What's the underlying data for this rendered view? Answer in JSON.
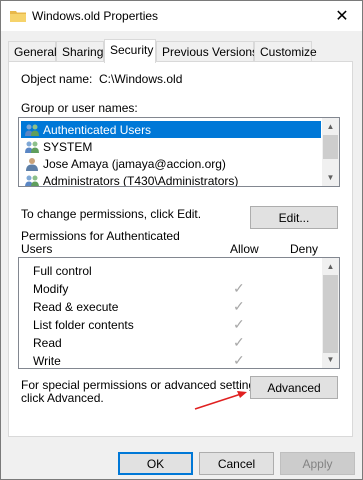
{
  "window": {
    "title": "Windows.old Properties",
    "close_glyph": "✕"
  },
  "tabs": [
    {
      "label": "General"
    },
    {
      "label": "Sharing"
    },
    {
      "label": "Security"
    },
    {
      "label": "Previous Versions"
    },
    {
      "label": "Customize"
    }
  ],
  "security": {
    "object_name_label": "Object name:",
    "object_name_value": "C:\\Windows.old",
    "group_label": "Group or user names:",
    "users": [
      {
        "name": "Authenticated Users",
        "icon": "users-group-icon",
        "selected": true
      },
      {
        "name": "SYSTEM",
        "icon": "users-group-icon",
        "selected": false
      },
      {
        "name": "Jose Amaya (jamaya@accion.org)",
        "icon": "user-icon",
        "selected": false
      },
      {
        "name": "Administrators (T430\\Administrators)",
        "icon": "users-group-icon",
        "selected": false
      }
    ],
    "change_text": "To change permissions, click Edit.",
    "edit_button": "Edit...",
    "permissions_for_line1": "Permissions for Authenticated",
    "permissions_for_line2": "Users",
    "allow_header": "Allow",
    "deny_header": "Deny",
    "permissions": [
      {
        "name": "Full control",
        "allow": false
      },
      {
        "name": "Modify",
        "allow": true
      },
      {
        "name": "Read & execute",
        "allow": true
      },
      {
        "name": "List folder contents",
        "allow": true
      },
      {
        "name": "Read",
        "allow": true
      },
      {
        "name": "Write",
        "allow": true
      }
    ],
    "special_text_line1": "For special permissions or advanced settings,",
    "special_text_line2": "click Advanced.",
    "advanced_button": "Advanced"
  },
  "footer": {
    "ok": "OK",
    "cancel": "Cancel",
    "apply": "Apply"
  },
  "colors": {
    "selection": "#0078d7",
    "annotation_arrow": "#e02020"
  }
}
